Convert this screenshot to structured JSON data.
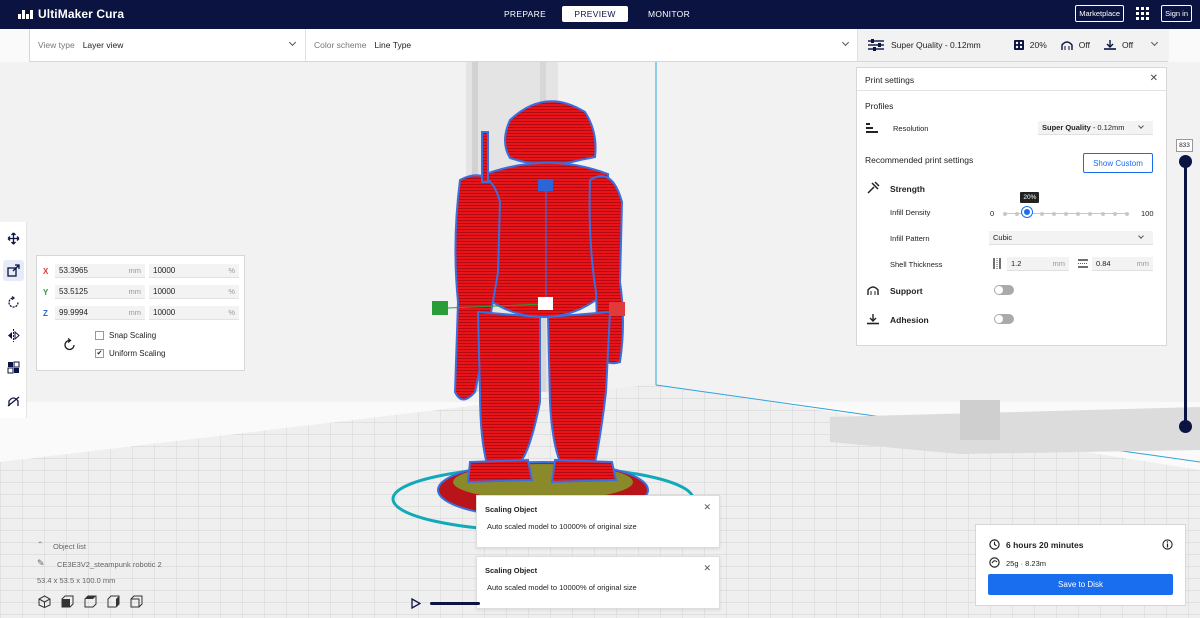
{
  "app": {
    "name": "UltiMaker Cura"
  },
  "stages": [
    {
      "label": "PREPARE",
      "active": false
    },
    {
      "label": "PREVIEW",
      "active": true
    },
    {
      "label": "MONITOR",
      "active": false
    }
  ],
  "topbar": {
    "marketplace": "Marketplace",
    "signin": "Sign in"
  },
  "header": {
    "view_type_label": "View type",
    "view_type_value": "Layer view",
    "color_scheme_label": "Color scheme",
    "color_scheme_value": "Line Type",
    "profile": "Super Quality - 0.12mm",
    "infill": "20%",
    "support": "Off",
    "adhesion": "Off"
  },
  "scale": {
    "x": {
      "axis": "X",
      "mm": "53.3965",
      "pct": "10000",
      "mm_unit": "mm",
      "pct_unit": "%"
    },
    "y": {
      "axis": "Y",
      "mm": "53.5125",
      "pct": "10000",
      "mm_unit": "mm",
      "pct_unit": "%"
    },
    "z": {
      "axis": "Z",
      "mm": "99.9994",
      "pct": "10000",
      "mm_unit": "mm",
      "pct_unit": "%"
    },
    "snap_label": "Snap Scaling",
    "snap_checked": false,
    "uniform_label": "Uniform Scaling",
    "uniform_checked": true
  },
  "print_settings": {
    "title": "Print settings",
    "profiles_label": "Profiles",
    "resolution_label": "Resolution",
    "resolution_bold": "Super Quality",
    "resolution_rest": " - 0.12mm",
    "recommended_label": "Recommended print settings",
    "show_custom": "Show Custom",
    "strength_label": "Strength",
    "infill_density_label": "Infill Density",
    "infill_min": "0",
    "infill_max": "100",
    "infill_value": 20,
    "infill_tip": "20%",
    "infill_pattern_label": "Infill Pattern",
    "infill_pattern_value": "Cubic",
    "shell_thickness_label": "Shell Thickness",
    "wall_value": "1.2",
    "top_value": "0.84",
    "unit": "mm",
    "support_label": "Support",
    "adhesion_label": "Adhesion"
  },
  "layer": {
    "value": "833"
  },
  "toasts": [
    {
      "title": "Scaling Object",
      "body": "Auto scaled model to 10000% of original size"
    },
    {
      "title": "Scaling Object",
      "body": "Auto scaled model to 10000% of original size"
    }
  ],
  "object_list": {
    "label": "Object list",
    "name": "CE3E3V2_steampunk robotic 2",
    "dims": "53.4 x 53.5 x 100.0 mm"
  },
  "summary": {
    "time": "6 hours 20 minutes",
    "material": "25g · 8.23m",
    "save": "Save to Disk"
  },
  "colors": {
    "brand": "#0b1340",
    "accent": "#196ef0",
    "model": "#e8141a",
    "outline": "#3a6fe0",
    "x_handle": "#e23a3a",
    "y_handle": "#2a9d3a",
    "z_handle": "#2a66d8"
  }
}
